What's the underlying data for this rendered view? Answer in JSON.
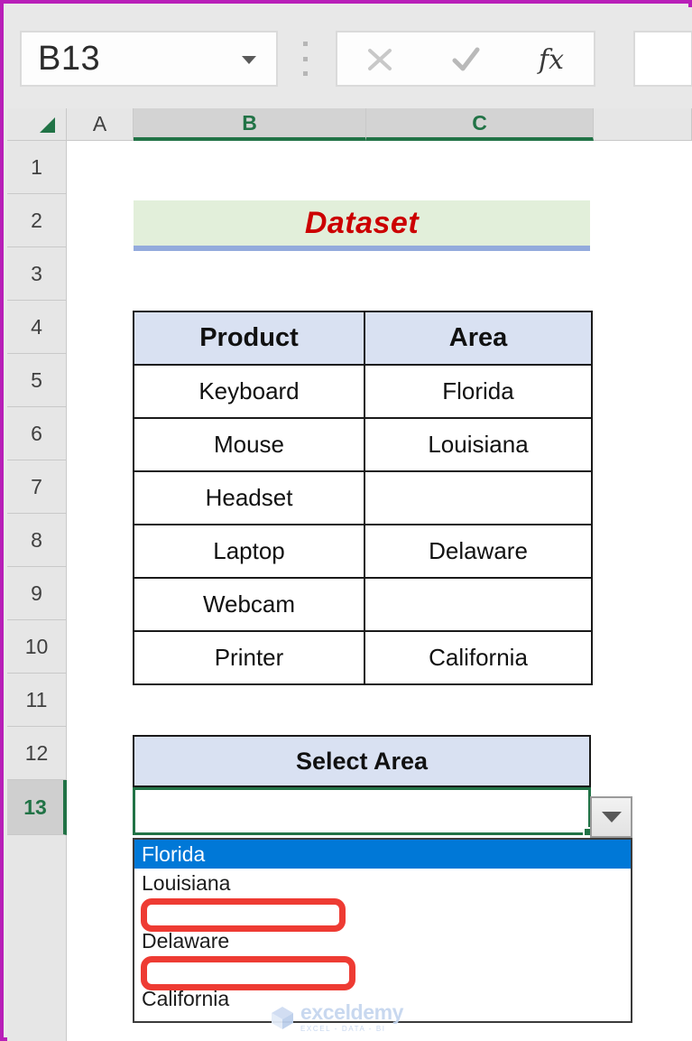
{
  "app": "excel-worksheet",
  "formula_bar": {
    "name_box_value": "B13",
    "name_box_dropdown_icon": "chevron-down-icon",
    "grip_icon": "vertical-dots-grip-icon",
    "cancel_icon": "cancel-x-icon",
    "enter_icon": "enter-check-icon",
    "insert_function_icon": "fx-insert-function-icon",
    "formula_value": ""
  },
  "grid": {
    "select_all_icon": "select-all-corner-icon",
    "columns": [
      {
        "letter": "A",
        "selected": false
      },
      {
        "letter": "B",
        "selected": true
      },
      {
        "letter": "C",
        "selected": true
      }
    ],
    "rows": [
      {
        "number": "1",
        "selected": false
      },
      {
        "number": "2",
        "selected": false
      },
      {
        "number": "3",
        "selected": false
      },
      {
        "number": "4",
        "selected": false
      },
      {
        "number": "5",
        "selected": false
      },
      {
        "number": "6",
        "selected": false
      },
      {
        "number": "7",
        "selected": false
      },
      {
        "number": "8",
        "selected": false
      },
      {
        "number": "9",
        "selected": false
      },
      {
        "number": "10",
        "selected": false
      },
      {
        "number": "11",
        "selected": false
      },
      {
        "number": "12",
        "selected": false
      },
      {
        "number": "13",
        "selected": true
      }
    ]
  },
  "sheet": {
    "title_cell": {
      "text": "Dataset",
      "fill_color": "#e2efda",
      "text_color": "#CC0000",
      "underline_color": "#93ABDC"
    },
    "table": {
      "header_fill": "#d9e1f2",
      "headers": [
        "Product",
        "Area"
      ],
      "rows": [
        {
          "product": "Keyboard",
          "area": "Florida"
        },
        {
          "product": "Mouse",
          "area": "Louisiana"
        },
        {
          "product": "Headset",
          "area": ""
        },
        {
          "product": "Laptop",
          "area": "Delaware"
        },
        {
          "product": "Webcam",
          "area": ""
        },
        {
          "product": "Printer",
          "area": "California"
        }
      ]
    },
    "select_area": {
      "header_label": "Select Area",
      "cell_value": "",
      "dropdown_icon": "dropdown-caret-icon",
      "selection_border_color": "#217346",
      "list_items": [
        {
          "label": "Florida",
          "selected": true,
          "blank": false
        },
        {
          "label": "Louisiana",
          "selected": false,
          "blank": false
        },
        {
          "label": "",
          "selected": false,
          "blank": true
        },
        {
          "label": "Delaware",
          "selected": false,
          "blank": false
        },
        {
          "label": "",
          "selected": false,
          "blank": true
        },
        {
          "label": "California",
          "selected": false,
          "blank": false
        }
      ],
      "highlight_color": "#0078D7"
    },
    "annotations": [
      {
        "shape": "rounded-rect",
        "color": "#ee3b33",
        "targets": "blank-list-item-3"
      },
      {
        "shape": "rounded-rect",
        "color": "#ee3b33",
        "targets": "blank-list-item-5"
      }
    ]
  },
  "watermark": {
    "brand": "exceldemy",
    "tagline": "EXCEL - DATA - BI",
    "logo_icon": "exceldemy-cube-logo-icon"
  }
}
